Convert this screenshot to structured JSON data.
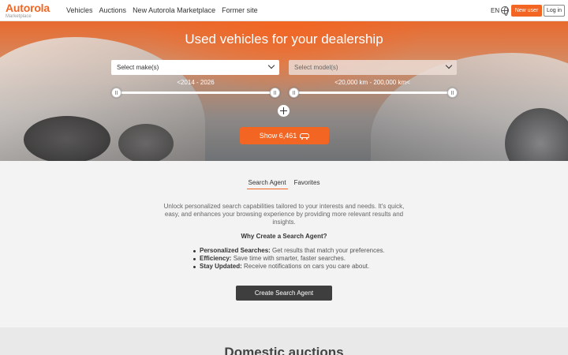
{
  "header": {
    "logo_name": "Autorola",
    "logo_sub": "Marketplace",
    "nav": [
      "Vehicles",
      "Auctions",
      "New Autorola Marketplace",
      "Former site"
    ],
    "language": "EN",
    "new_user_label": "New user",
    "login_label": "Log in"
  },
  "hero": {
    "title": "Used vehicles for your dealership",
    "make_select": "Select make(s)",
    "model_select": "Select model(s)",
    "year_range_label": "<2014 - 2026",
    "km_range_label": "<20,000 km - 200,000 km<",
    "show_button": "Show 6,461"
  },
  "search_agent": {
    "tabs": [
      "Search Agent",
      "Favorites"
    ],
    "active_tab": "Search Agent",
    "intro": "Unlock personalized search capabilities tailored to your interests and needs. It's quick, easy, and enhances your browsing experience by providing more relevant results and insights.",
    "why_title": "Why Create a Search Agent?",
    "benefits": [
      {
        "title": "Personalized Searches:",
        "text": " Get results that match your preferences."
      },
      {
        "title": "Efficiency:",
        "text": " Save time with smarter, faster searches."
      },
      {
        "title": "Stay Updated:",
        "text": " Receive notifications on cars you care about."
      }
    ],
    "create_button": "Create Search Agent"
  },
  "bottom": {
    "title": "Domestic auctions"
  },
  "colors": {
    "accent": "#f26522",
    "dark_button": "#3e3e3e"
  }
}
